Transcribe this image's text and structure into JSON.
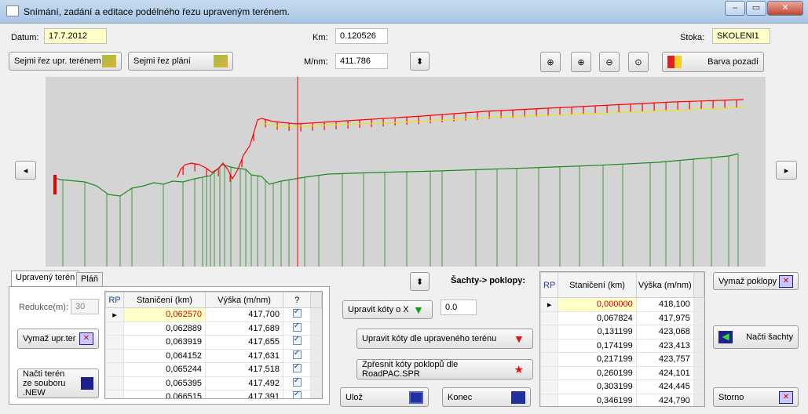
{
  "window": {
    "title": "Snímání, zadání a editace podélného řezu upraveným terénem."
  },
  "header": {
    "datum_label": "Datum:",
    "datum_value": "17.7.2012",
    "km_label": "Km:",
    "km_value": "0.120526",
    "stoka_label": "Stoka:",
    "stoka_value": "SKOLENI1",
    "mnm_label": "M/nm:",
    "mnm_value": "411.786"
  },
  "buttons": {
    "sejmi_upr": "Sejmi řez  upr. terénem",
    "sejmi_plani": "Sejmi řez  plání",
    "barva_pozadi": "Barva pozadí",
    "vymaz_upr": "Vymaž upr.ter",
    "nacti_teren_1": "Načti terén",
    "nacti_teren_2": "ze souboru .NEW",
    "upravit_x": "Upravit kóty  o X",
    "upravit_x_value": "0.0",
    "upravit_dle": "Upravit kóty  dle upraveného terénu",
    "zpresnit": "Zpřesnit kóty poklopů dle RoadPAC.SPR",
    "uloz": "Ulož",
    "konec": "Konec",
    "vymaz_poklopy": "Vymaž poklopy",
    "nacti_sachty": "Načti šachty",
    "storno": "Storno"
  },
  "tabs": [
    "Upravený terén",
    "Pláň"
  ],
  "reduction": {
    "label": "Redukce(m):",
    "value": "30"
  },
  "sachty_label": "Šachty-> poklopy:",
  "left_table": {
    "headers": [
      "RP",
      "Staničení (km)",
      "Výška (m/nm)",
      "?"
    ],
    "rows": [
      [
        "0,062570",
        "417,700"
      ],
      [
        "0,062889",
        "417,689"
      ],
      [
        "0,063919",
        "417,655"
      ],
      [
        "0,064152",
        "417,631"
      ],
      [
        "0,065244",
        "417,518"
      ],
      [
        "0,065395",
        "417,492"
      ],
      [
        "0,066515",
        "417,391"
      ]
    ]
  },
  "right_table": {
    "headers": [
      "RP",
      "Staničení (km)",
      "Výška (m/nm)"
    ],
    "rows": [
      [
        "0,000000",
        "418,100"
      ],
      [
        "0,067824",
        "417,975"
      ],
      [
        "0,131199",
        "423,068"
      ],
      [
        "0,174199",
        "423,413"
      ],
      [
        "0,217199",
        "423,757"
      ],
      [
        "0,260199",
        "424,101"
      ],
      [
        "0,303199",
        "424,445"
      ],
      [
        "0,346199",
        "424,790"
      ]
    ]
  },
  "colors": {
    "plot_bg": "#d4d4d4",
    "terrain": "#1e8a1e",
    "profile": "#ff0000",
    "axis": "#e8e800",
    "cursor": "#ff0000"
  },
  "icons": [
    "app-icon",
    "zoom-all-icon",
    "zoom-in-icon",
    "zoom-out-icon",
    "zoom-window-icon",
    "palette-icon",
    "scroll-left-icon",
    "scroll-right-icon",
    "updown-icon",
    "save-icon",
    "exit-icon"
  ]
}
